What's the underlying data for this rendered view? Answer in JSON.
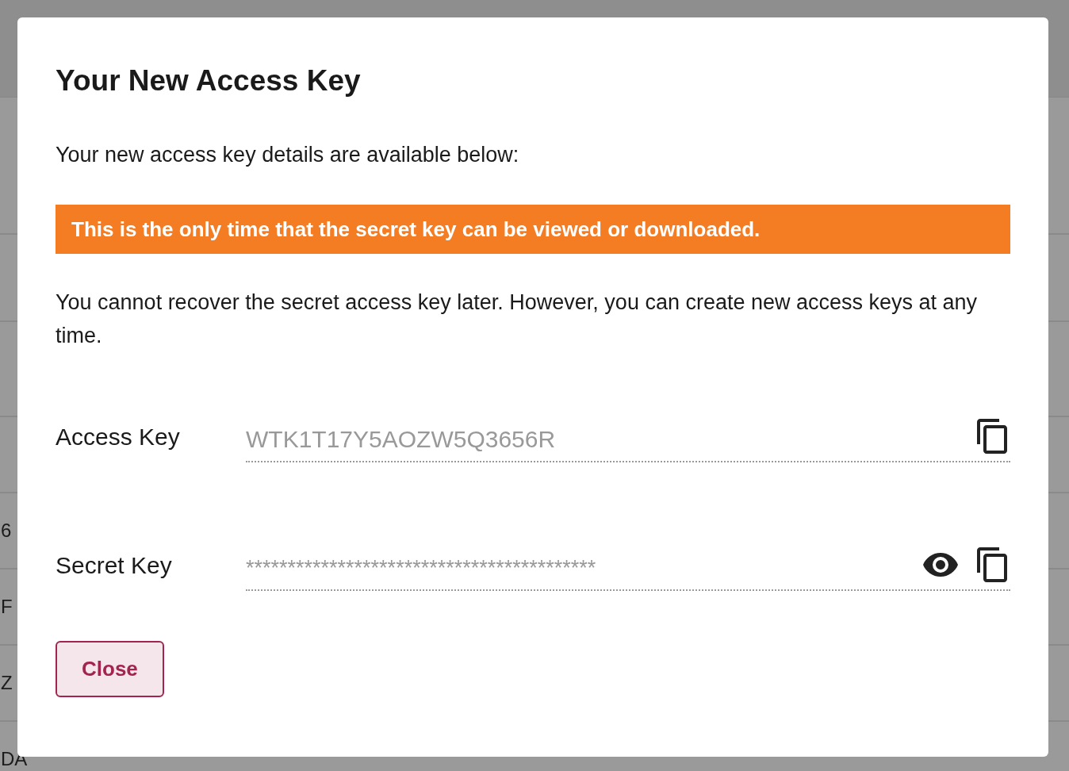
{
  "background_table": {
    "rows": [
      {
        "column_1": "6"
      },
      {
        "column_1": "F"
      },
      {
        "column_1": "Z"
      },
      {
        "column_1": "DA"
      }
    ]
  },
  "dialog": {
    "title": "Your New Access Key",
    "intro": "Your new access key details are available below:",
    "warning": "This is the only time that the secret key can be viewed or downloaded.",
    "note": "You cannot recover the secret access key later. However, you can create new access keys at any time.",
    "fields": [
      {
        "label": "Access Key",
        "value": "WTK1T17Y5AOZW5Q3656R",
        "kind": "plain"
      },
      {
        "label": "Secret Key",
        "value": "******************************************",
        "kind": "secret"
      }
    ],
    "buttons": [
      "Close"
    ]
  }
}
